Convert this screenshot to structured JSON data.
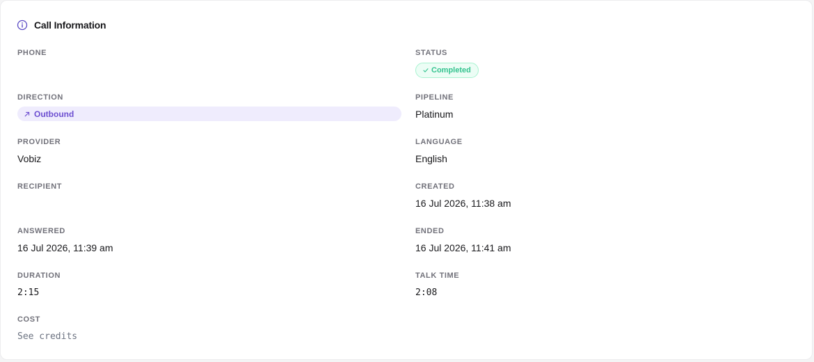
{
  "card": {
    "title": "Call Information",
    "icon": "info-icon"
  },
  "fields": {
    "phone": {
      "label": "PHONE",
      "value": ""
    },
    "status": {
      "label": "STATUS",
      "value": "Completed",
      "icon": "check-icon",
      "color": "#34c38f",
      "bg": "#ecfdf5"
    },
    "direction": {
      "label": "DIRECTION",
      "value": "Outbound",
      "icon": "arrow-up-right-icon",
      "color": "#6d4fd1",
      "bg": "#efecfd"
    },
    "pipeline": {
      "label": "PIPELINE",
      "value": "Platinum"
    },
    "provider": {
      "label": "PROVIDER",
      "value": "Vobiz"
    },
    "language": {
      "label": "LANGUAGE",
      "value": "English"
    },
    "recipient": {
      "label": "RECIPIENT",
      "value": ""
    },
    "created": {
      "label": "CREATED",
      "value": "16 Jul 2026, 11:38 am"
    },
    "answered": {
      "label": "ANSWERED",
      "value": "16 Jul 2026, 11:39 am"
    },
    "ended": {
      "label": "ENDED",
      "value": "16 Jul 2026, 11:41 am"
    },
    "duration": {
      "label": "DURATION",
      "value": "2:15"
    },
    "talk_time": {
      "label": "TALK TIME",
      "value": "2:08"
    },
    "cost": {
      "label": "COST",
      "value": "See credits"
    }
  }
}
